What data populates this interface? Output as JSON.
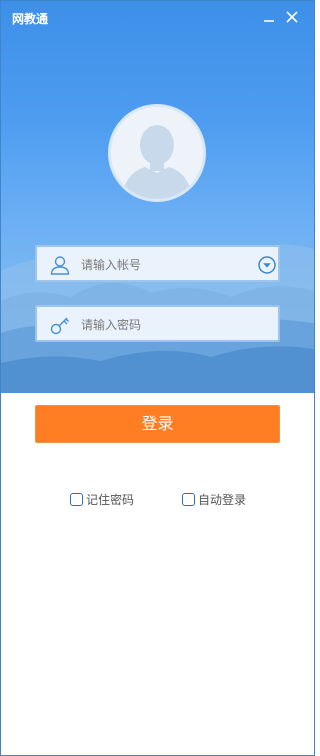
{
  "window": {
    "title": "网教通"
  },
  "login": {
    "username_placeholder": "请输入帐号",
    "password_placeholder": "请输入密码",
    "submit_label": "登录",
    "remember_password_label": "记住密码",
    "auto_login_label": "自动登录"
  },
  "colors": {
    "accent": "#ff7e24",
    "sky": "#4d9cf0",
    "border": "#3f86c8",
    "field_bg": "#eaf2fc"
  },
  "icons": {
    "minimize": "minimize-icon",
    "close": "close-icon",
    "user": "user-icon",
    "key": "key-icon",
    "dropdown": "chevron-down-circle-icon",
    "avatar": "avatar-placeholder"
  }
}
